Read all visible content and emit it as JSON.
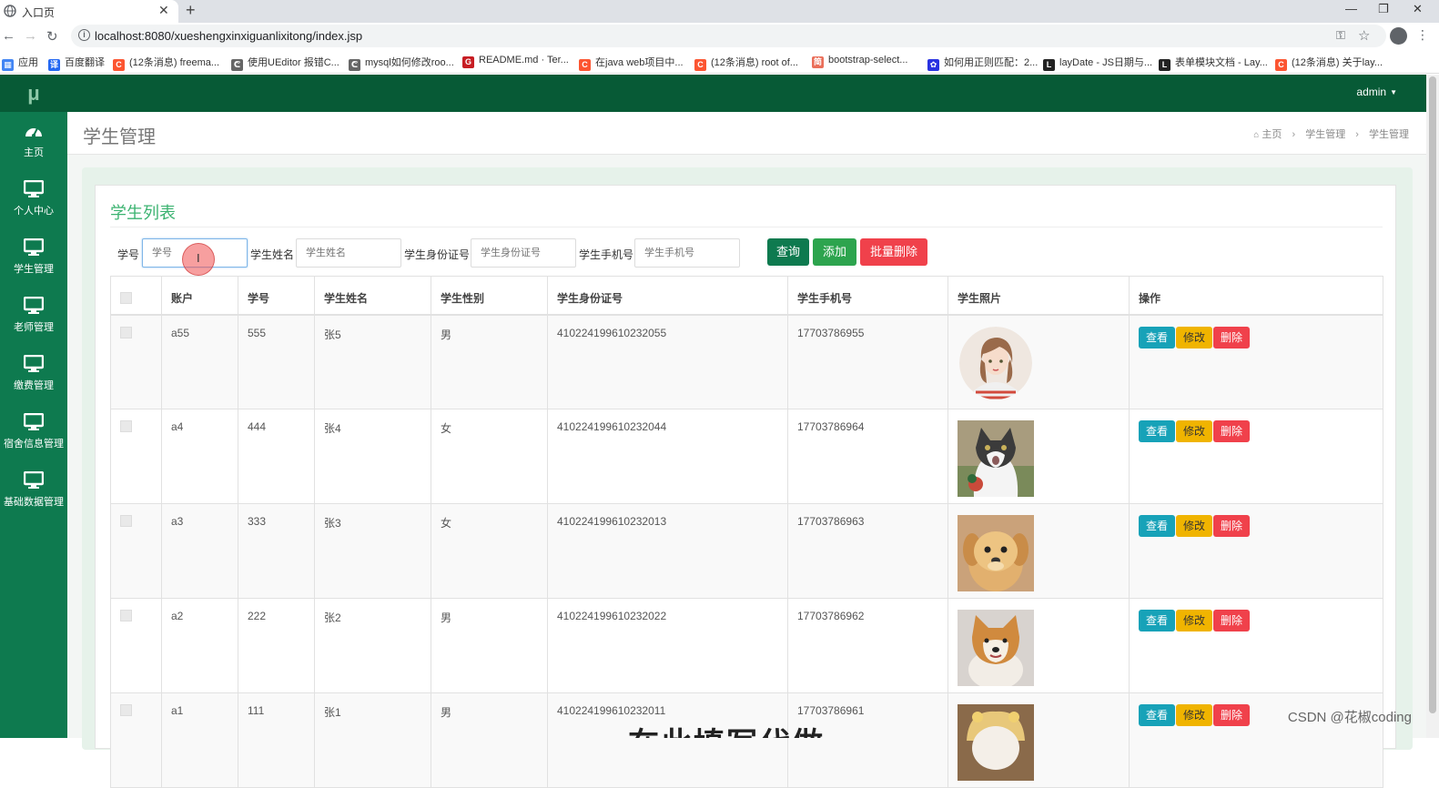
{
  "browser": {
    "tab_title": "入口页",
    "url": "localhost:8080/xueshengxinxiguanlixitong/index.jsp",
    "bookmarks": [
      {
        "label": "应用",
        "icon": "apps-grid-icon",
        "color": "#4285f4"
      },
      {
        "label": "百度翻译",
        "icon": "baidu-translate-icon",
        "color": "#2468f2"
      },
      {
        "label": "(12条消息) freema...",
        "icon": "csdn-icon",
        "color": "#fc5531"
      },
      {
        "label": "使用UEditor 报错C...",
        "icon": "ueditor-icon",
        "color": "#666666"
      },
      {
        "label": "mysql如何修改roo...",
        "icon": "ueditor-icon",
        "color": "#666666"
      },
      {
        "label": "README.md · Ter...",
        "icon": "gitee-icon",
        "color": "#c71d23"
      },
      {
        "label": "在java web项目中...",
        "icon": "csdn-icon",
        "color": "#fc5531"
      },
      {
        "label": "(12条消息) root of...",
        "icon": "csdn-icon",
        "color": "#fc5531"
      },
      {
        "label": "bootstrap-select...",
        "icon": "jianshu-icon",
        "color": "#ea6f5a"
      },
      {
        "label": "如何用正则匹配：2...",
        "icon": "baidu-icon",
        "color": "#2932e1"
      },
      {
        "label": "layDate - JS日期与...",
        "icon": "layui-icon",
        "color": "#222222"
      },
      {
        "label": "表单模块文档 - Lay...",
        "icon": "layui-icon",
        "color": "#222222"
      },
      {
        "label": "(12条消息) 关于lay...",
        "icon": "csdn-icon",
        "color": "#fc5531"
      }
    ]
  },
  "app": {
    "logo": "μ",
    "user": "admin",
    "colors": {
      "sidebar": "#0e7a4f",
      "topbar": "#075a36",
      "accent": "#3cb371"
    },
    "nav": [
      {
        "label": "主页",
        "icon": "dashboard-icon"
      },
      {
        "label": "个人中心",
        "icon": "monitor-icon"
      },
      {
        "label": "学生管理",
        "icon": "monitor-icon"
      },
      {
        "label": "老师管理",
        "icon": "monitor-icon"
      },
      {
        "label": "缴费管理",
        "icon": "monitor-icon"
      },
      {
        "label": "宿舍信息管理",
        "icon": "monitor-icon"
      },
      {
        "label": "基础数据管理",
        "icon": "monitor-icon"
      }
    ],
    "page_title": "学生管理",
    "breadcrumb": [
      "主页",
      "学生管理",
      "学生管理"
    ]
  },
  "list": {
    "title": "学生列表",
    "filters": [
      {
        "label": "学号",
        "placeholder": "学号"
      },
      {
        "label": "学生姓名",
        "placeholder": "学生姓名"
      },
      {
        "label": "学生身份证号",
        "placeholder": "学生身份证号"
      },
      {
        "label": "学生手机号",
        "placeholder": "学生手机号"
      }
    ],
    "buttons": {
      "query": "查询",
      "add": "添加",
      "batch_delete": "批量删除"
    },
    "columns": [
      "账户",
      "学号",
      "学生姓名",
      "学生性别",
      "学生身份证号",
      "学生手机号",
      "学生照片",
      "操作"
    ],
    "row_actions": {
      "view": "查看",
      "edit": "修改",
      "delete": "删除"
    },
    "rows": [
      {
        "account": "a55",
        "no": "555",
        "name": "张5",
        "gender": "男",
        "id_card": "410224199610232055",
        "phone": "17703786955",
        "photo": "girl-avatar"
      },
      {
        "account": "a4",
        "no": "444",
        "name": "张4",
        "gender": "女",
        "id_card": "410224199610232044",
        "phone": "17703786964",
        "photo": "cat"
      },
      {
        "account": "a3",
        "no": "333",
        "name": "张3",
        "gender": "女",
        "id_card": "410224199610232013",
        "phone": "17703786963",
        "photo": "puppy"
      },
      {
        "account": "a2",
        "no": "222",
        "name": "张2",
        "gender": "男",
        "id_card": "410224199610232022",
        "phone": "17703786962",
        "photo": "shiba"
      },
      {
        "account": "a1",
        "no": "111",
        "name": "张1",
        "gender": "男",
        "id_card": "410224199610232011",
        "phone": "17703786961",
        "photo": "dog"
      }
    ]
  },
  "overlay": {
    "watermark": "CSDN @花椒coding",
    "subtitle": "在此填写代做"
  }
}
